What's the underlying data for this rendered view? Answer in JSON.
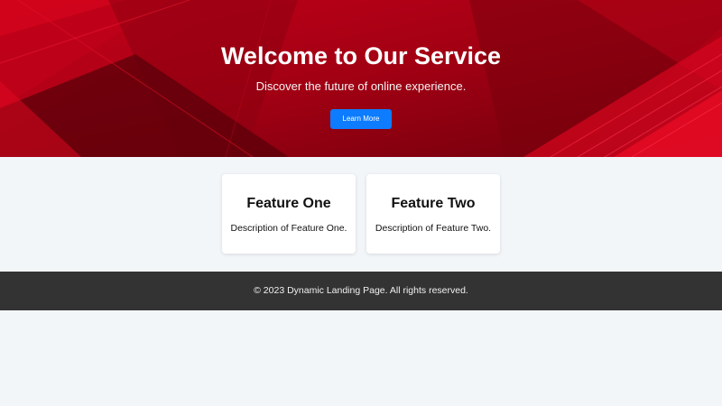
{
  "hero": {
    "title": "Welcome to Our Service",
    "subtitle": "Discover the future of online experience.",
    "button_label": "Learn More",
    "background_color": "#9a0010",
    "button_color": "#0d7cff"
  },
  "features": [
    {
      "title": "Feature One",
      "description": "Description of Feature One."
    },
    {
      "title": "Feature Two",
      "description": "Description of Feature Two."
    }
  ],
  "footer": {
    "text": "© 2023 Dynamic Landing Page. All rights reserved.",
    "background_color": "#333333"
  }
}
